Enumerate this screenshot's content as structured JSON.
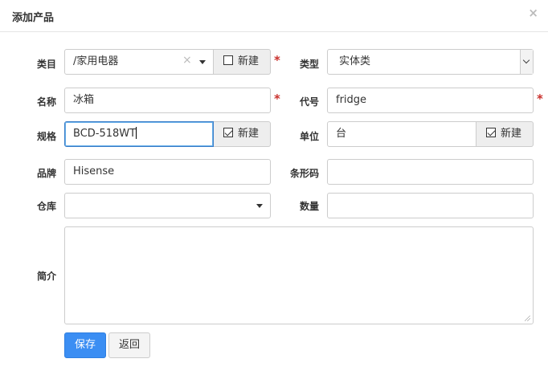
{
  "dialog": {
    "title": "添加产品",
    "close_symbol": "×"
  },
  "form": {
    "category": {
      "label": "类目",
      "value": "/家用电器",
      "clear_symbol": "×",
      "new_label": "新建",
      "new_checked": false
    },
    "type": {
      "label": "类型",
      "value": "实体类"
    },
    "name": {
      "label": "名称",
      "value": "冰箱"
    },
    "code": {
      "label": "代号",
      "value": "fridge"
    },
    "spec": {
      "label": "规格",
      "value": "BCD-518WT",
      "new_label": "新建",
      "new_checked": true
    },
    "unit": {
      "label": "单位",
      "value": "台",
      "new_label": "新建",
      "new_checked": true
    },
    "brand": {
      "label": "品牌",
      "value": "Hisense"
    },
    "barcode": {
      "label": "条形码",
      "value": ""
    },
    "warehouse": {
      "label": "仓库",
      "value": ""
    },
    "quantity": {
      "label": "数量",
      "value": ""
    },
    "intro": {
      "label": "简介",
      "value": ""
    },
    "required_mark": "*"
  },
  "actions": {
    "save_label": "保存",
    "back_label": "返回"
  }
}
